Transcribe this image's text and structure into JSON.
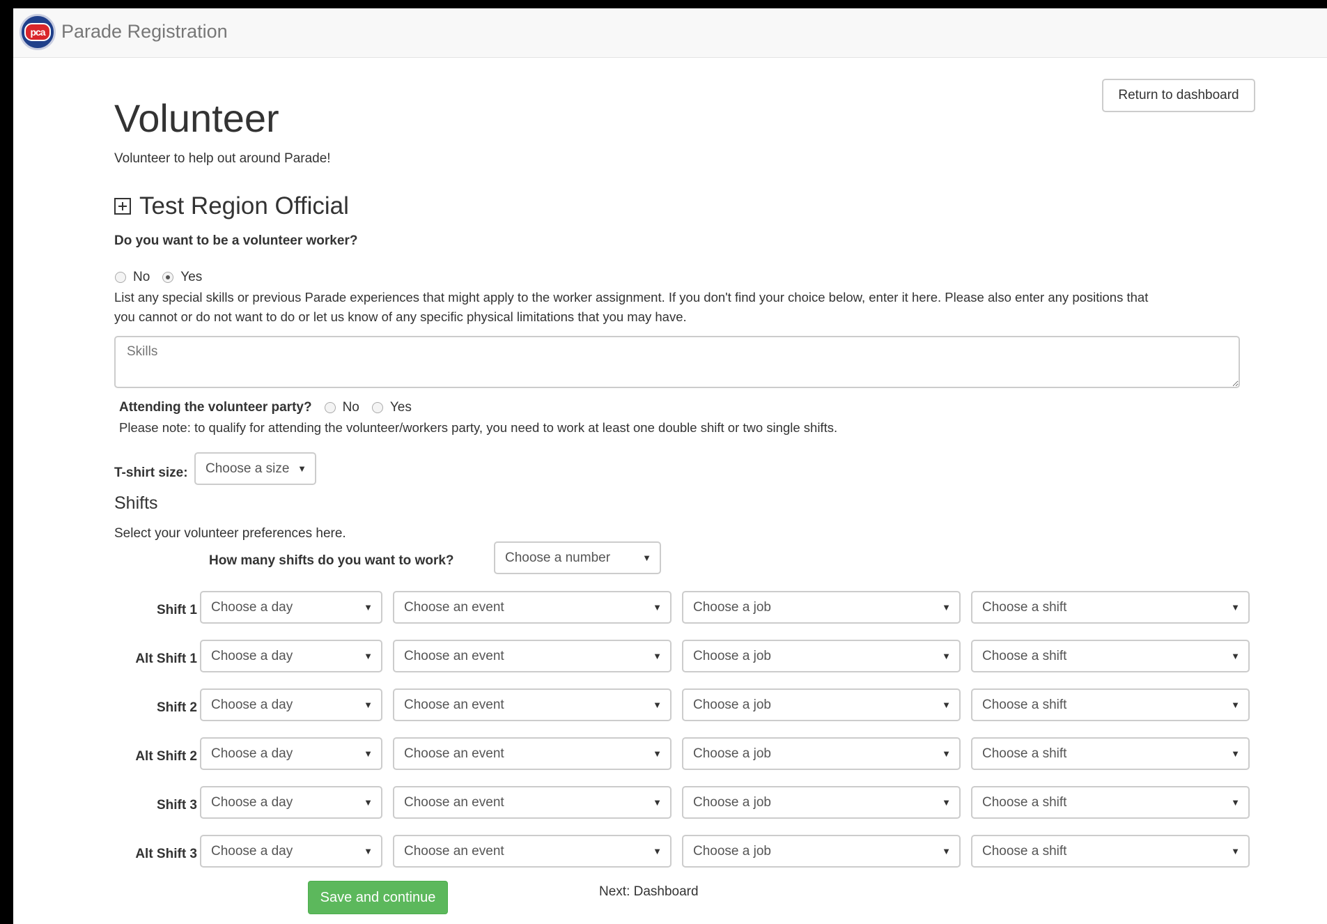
{
  "navbar": {
    "brand": "Parade Registration",
    "logo_text": "pca"
  },
  "header": {
    "return_button": "Return to dashboard",
    "title": "Volunteer",
    "subtitle": "Volunteer to help out around Parade!"
  },
  "section": {
    "title": "Test Region Official",
    "expand_icon": "plus-square-icon"
  },
  "worker": {
    "question": "Do you want to be a volunteer worker?",
    "options": [
      "No",
      "Yes"
    ],
    "selected": "Yes",
    "skills_help": "List any special skills or previous Parade experiences that might apply to the worker assignment. If you don't find your choice below, enter it here. Please also enter any positions that",
    "skills_help_2": "you cannot or do not want to do or let us know of any specific physical limitations that you may have.",
    "skills_placeholder": "Skills"
  },
  "party": {
    "question": "Attending the volunteer party?",
    "options": [
      "No",
      "Yes"
    ],
    "note": "Please note: to qualify for attending the volunteer/workers party, you need to work at least one double shift or two single shifts."
  },
  "tshirt": {
    "label": "T-shirt size:",
    "placeholder": "Choose a size"
  },
  "shifts": {
    "heading": "Shifts",
    "help": "Select your volunteer preferences here.",
    "count_label": "How many shifts do you want to work?",
    "count_placeholder": "Choose a number",
    "rows": [
      {
        "label": "Shift 1",
        "day": "Choose a day",
        "event": "Choose an event",
        "job": "Choose a job",
        "shift": "Choose a shift"
      },
      {
        "label": "Alt Shift 1",
        "day": "Choose a day",
        "event": "Choose an event",
        "job": "Choose a job",
        "shift": "Choose a shift"
      },
      {
        "label": "Shift 2",
        "day": "Choose a day",
        "event": "Choose an event",
        "job": "Choose a job",
        "shift": "Choose a shift"
      },
      {
        "label": "Alt Shift 2",
        "day": "Choose a day",
        "event": "Choose an event",
        "job": "Choose a job",
        "shift": "Choose a shift"
      },
      {
        "label": "Shift 3",
        "day": "Choose a day",
        "event": "Choose an event",
        "job": "Choose a job",
        "shift": "Choose a shift"
      },
      {
        "label": "Alt Shift 3",
        "day": "Choose a day",
        "event": "Choose an event",
        "job": "Choose a job",
        "shift": "Choose a shift"
      }
    ]
  },
  "footer": {
    "save_button": "Save and continue",
    "next_text": "Next: Dashboard"
  },
  "colors": {
    "success": "#5cb85c",
    "navbar": "#f8f8f8",
    "border": "#cccccc"
  }
}
